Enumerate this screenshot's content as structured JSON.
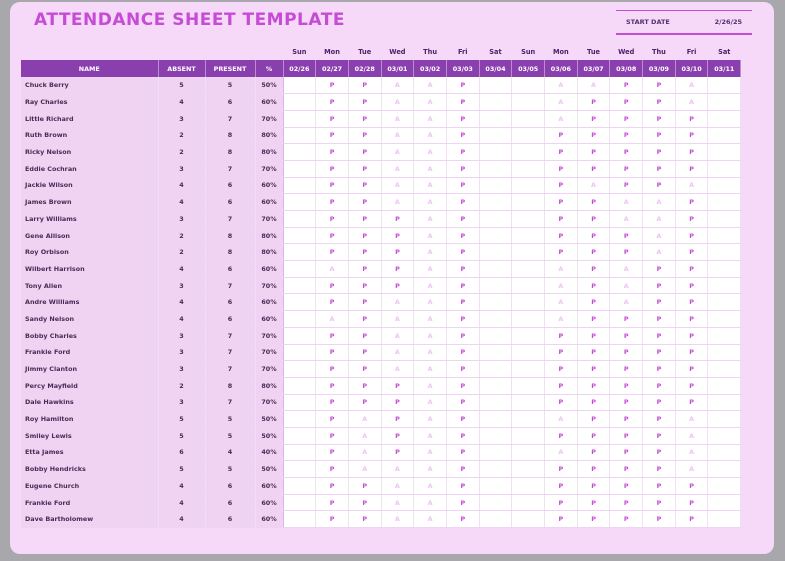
{
  "title": "ATTENDANCE SHEET TEMPLATE",
  "start_date": {
    "label": "START DATE",
    "value": "2/26/25"
  },
  "headers": {
    "name": "NAME",
    "absent": "ABSENT",
    "present": "PRESENT",
    "percent": "%"
  },
  "days": [
    {
      "dow": "Sun",
      "date": "02/26"
    },
    {
      "dow": "Mon",
      "date": "02/27"
    },
    {
      "dow": "Tue",
      "date": "02/28"
    },
    {
      "dow": "Wed",
      "date": "03/01"
    },
    {
      "dow": "Thu",
      "date": "03/02"
    },
    {
      "dow": "Fri",
      "date": "03/03"
    },
    {
      "dow": "Sat",
      "date": "03/04"
    },
    {
      "dow": "Sun",
      "date": "03/05"
    },
    {
      "dow": "Mon",
      "date": "03/06"
    },
    {
      "dow": "Tue",
      "date": "03/07"
    },
    {
      "dow": "Wed",
      "date": "03/08"
    },
    {
      "dow": "Thu",
      "date": "03/09"
    },
    {
      "dow": "Fri",
      "date": "03/10"
    },
    {
      "dow": "Sat",
      "date": "03/11"
    }
  ],
  "students": [
    {
      "name": "Chuck Berry",
      "absent": "5",
      "present": "5",
      "percent": "50%",
      "marks": [
        "",
        "P",
        "P",
        "A",
        "A",
        "P",
        "",
        "",
        "A",
        "A",
        "P",
        "P",
        "A",
        ""
      ]
    },
    {
      "name": "Ray Charles",
      "absent": "4",
      "present": "6",
      "percent": "60%",
      "marks": [
        "",
        "P",
        "P",
        "A",
        "A",
        "P",
        "",
        "",
        "A",
        "P",
        "P",
        "P",
        "A",
        ""
      ]
    },
    {
      "name": "Little Richard",
      "absent": "3",
      "present": "7",
      "percent": "70%",
      "marks": [
        "",
        "P",
        "P",
        "A",
        "A",
        "P",
        "",
        "",
        "A",
        "P",
        "P",
        "P",
        "P",
        ""
      ]
    },
    {
      "name": "Ruth Brown",
      "absent": "2",
      "present": "8",
      "percent": "80%",
      "marks": [
        "",
        "P",
        "P",
        "A",
        "A",
        "P",
        "",
        "",
        "P",
        "P",
        "P",
        "P",
        "P",
        ""
      ]
    },
    {
      "name": "Ricky Nelson",
      "absent": "2",
      "present": "8",
      "percent": "80%",
      "marks": [
        "",
        "P",
        "P",
        "A",
        "A",
        "P",
        "",
        "",
        "P",
        "P",
        "P",
        "P",
        "P",
        ""
      ]
    },
    {
      "name": "Eddie Cochran",
      "absent": "3",
      "present": "7",
      "percent": "70%",
      "marks": [
        "",
        "P",
        "P",
        "A",
        "A",
        "P",
        "",
        "",
        "P",
        "P",
        "P",
        "P",
        "P",
        ""
      ]
    },
    {
      "name": "Jackie Wilson",
      "absent": "4",
      "present": "6",
      "percent": "60%",
      "marks": [
        "",
        "P",
        "P",
        "A",
        "A",
        "P",
        "",
        "",
        "P",
        "A",
        "P",
        "P",
        "A",
        ""
      ]
    },
    {
      "name": "James Brown",
      "absent": "4",
      "present": "6",
      "percent": "60%",
      "marks": [
        "",
        "P",
        "P",
        "A",
        "A",
        "P",
        "",
        "",
        "P",
        "P",
        "A",
        "A",
        "P",
        ""
      ]
    },
    {
      "name": "Larry Williams",
      "absent": "3",
      "present": "7",
      "percent": "70%",
      "marks": [
        "",
        "P",
        "P",
        "P",
        "A",
        "P",
        "",
        "",
        "P",
        "P",
        "A",
        "A",
        "P",
        ""
      ]
    },
    {
      "name": "Gene Allison",
      "absent": "2",
      "present": "8",
      "percent": "80%",
      "marks": [
        "",
        "P",
        "P",
        "P",
        "A",
        "P",
        "",
        "",
        "P",
        "P",
        "P",
        "A",
        "P",
        ""
      ]
    },
    {
      "name": "Roy Orbison",
      "absent": "2",
      "present": "8",
      "percent": "80%",
      "marks": [
        "",
        "P",
        "P",
        "P",
        "A",
        "P",
        "",
        "",
        "P",
        "P",
        "P",
        "A",
        "P",
        ""
      ]
    },
    {
      "name": "Wilbert Harrison",
      "absent": "4",
      "present": "6",
      "percent": "60%",
      "marks": [
        "",
        "A",
        "P",
        "P",
        "A",
        "P",
        "",
        "",
        "A",
        "P",
        "A",
        "P",
        "P",
        ""
      ]
    },
    {
      "name": "Tony Allen",
      "absent": "3",
      "present": "7",
      "percent": "70%",
      "marks": [
        "",
        "P",
        "P",
        "P",
        "A",
        "P",
        "",
        "",
        "A",
        "P",
        "A",
        "P",
        "P",
        ""
      ]
    },
    {
      "name": "Andre Williams",
      "absent": "4",
      "present": "6",
      "percent": "60%",
      "marks": [
        "",
        "P",
        "P",
        "A",
        "A",
        "P",
        "",
        "",
        "A",
        "P",
        "A",
        "P",
        "P",
        ""
      ]
    },
    {
      "name": "Sandy Nelson",
      "absent": "4",
      "present": "6",
      "percent": "60%",
      "marks": [
        "",
        "A",
        "P",
        "A",
        "A",
        "P",
        "",
        "",
        "A",
        "P",
        "P",
        "P",
        "P",
        ""
      ]
    },
    {
      "name": "Bobby Charles",
      "absent": "3",
      "present": "7",
      "percent": "70%",
      "marks": [
        "",
        "P",
        "P",
        "A",
        "A",
        "P",
        "",
        "",
        "P",
        "P",
        "P",
        "P",
        "P",
        ""
      ]
    },
    {
      "name": "Frankie Ford",
      "absent": "3",
      "present": "7",
      "percent": "70%",
      "marks": [
        "",
        "P",
        "P",
        "A",
        "A",
        "P",
        "",
        "",
        "P",
        "P",
        "P",
        "P",
        "P",
        ""
      ]
    },
    {
      "name": "Jimmy Clanton",
      "absent": "3",
      "present": "7",
      "percent": "70%",
      "marks": [
        "",
        "P",
        "P",
        "A",
        "A",
        "P",
        "",
        "",
        "P",
        "P",
        "P",
        "P",
        "P",
        ""
      ]
    },
    {
      "name": "Percy Mayfield",
      "absent": "2",
      "present": "8",
      "percent": "80%",
      "marks": [
        "",
        "P",
        "P",
        "P",
        "A",
        "P",
        "",
        "",
        "P",
        "P",
        "P",
        "P",
        "P",
        ""
      ]
    },
    {
      "name": "Dale Hawkins",
      "absent": "3",
      "present": "7",
      "percent": "70%",
      "marks": [
        "",
        "P",
        "P",
        "P",
        "A",
        "P",
        "",
        "",
        "P",
        "P",
        "P",
        "P",
        "P",
        ""
      ]
    },
    {
      "name": "Roy Hamilton",
      "absent": "5",
      "present": "5",
      "percent": "50%",
      "marks": [
        "",
        "P",
        "A",
        "P",
        "A",
        "P",
        "",
        "",
        "A",
        "P",
        "P",
        "P",
        "A",
        ""
      ]
    },
    {
      "name": "Smiley Lewis",
      "absent": "5",
      "present": "5",
      "percent": "50%",
      "marks": [
        "",
        "P",
        "A",
        "P",
        "A",
        "P",
        "",
        "",
        "P",
        "P",
        "P",
        "P",
        "A",
        ""
      ]
    },
    {
      "name": "Etta James",
      "absent": "6",
      "present": "4",
      "percent": "40%",
      "marks": [
        "",
        "P",
        "A",
        "P",
        "A",
        "P",
        "",
        "",
        "A",
        "P",
        "P",
        "P",
        "A",
        ""
      ]
    },
    {
      "name": "Bobby Hendricks",
      "absent": "5",
      "present": "5",
      "percent": "50%",
      "marks": [
        "",
        "P",
        "A",
        "A",
        "A",
        "P",
        "",
        "",
        "P",
        "P",
        "P",
        "P",
        "A",
        ""
      ]
    },
    {
      "name": "Eugene Church",
      "absent": "4",
      "present": "6",
      "percent": "60%",
      "marks": [
        "",
        "P",
        "P",
        "A",
        "A",
        "P",
        "",
        "",
        "P",
        "P",
        "P",
        "P",
        "P",
        ""
      ]
    },
    {
      "name": "Frankie Ford",
      "absent": "4",
      "present": "6",
      "percent": "60%",
      "marks": [
        "",
        "P",
        "P",
        "A",
        "A",
        "P",
        "",
        "",
        "P",
        "P",
        "P",
        "P",
        "P",
        ""
      ]
    },
    {
      "name": "Dave Bartholomew",
      "absent": "4",
      "present": "6",
      "percent": "60%",
      "marks": [
        "",
        "P",
        "P",
        "A",
        "A",
        "P",
        "",
        "",
        "P",
        "P",
        "P",
        "P",
        "P",
        ""
      ]
    }
  ],
  "colors": {
    "accent": "#c64bd6",
    "header": "#8a3fae",
    "background": "#f6d8f8",
    "absent_mark": "#ecc6f0"
  }
}
